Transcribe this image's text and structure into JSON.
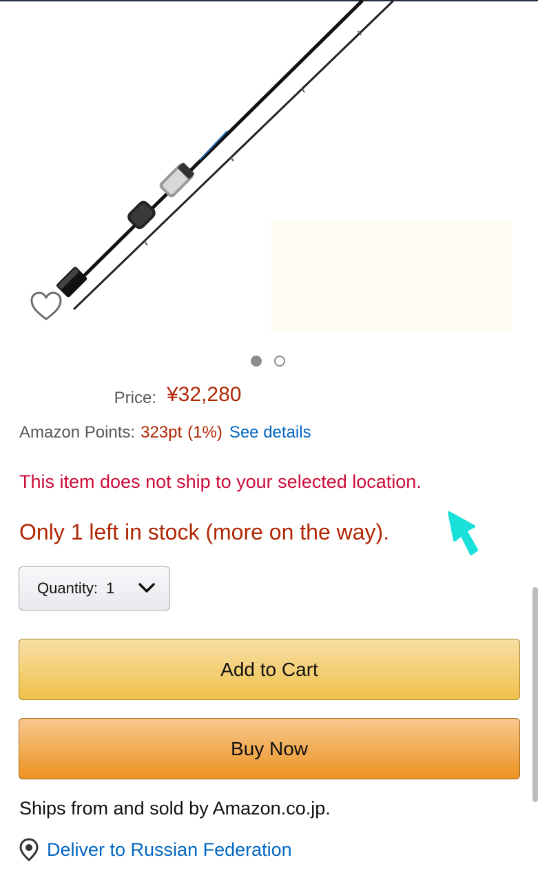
{
  "product": {
    "image_icon": "fishing-rod-product-image",
    "wishlist_icon": "heart-outline-icon",
    "carousel_pages": 2,
    "carousel_active": 1
  },
  "price": {
    "label": "Price:",
    "value": "¥32,280"
  },
  "points": {
    "label": "Amazon Points:",
    "value": "323pt",
    "percent": "(1%)",
    "link": "See details"
  },
  "alerts": {
    "no_ship": "This item does not ship to your selected location.",
    "stock": "Only 1 left in stock (more on the way)."
  },
  "quantity": {
    "label": "Quantity:",
    "value": "1",
    "icon": "chevron-down-icon"
  },
  "buttons": {
    "add_to_cart": "Add to Cart",
    "buy_now": "Buy Now"
  },
  "seller": {
    "text": "Ships from and sold by Amazon.co.jp."
  },
  "delivery": {
    "icon": "location-pin-icon",
    "text": "Deliver to Russian Federation"
  },
  "colors": {
    "price": "#b12704",
    "alert": "#cc0c39",
    "link": "#0066c0",
    "cart_button": "#f0c14b",
    "buy_button": "#ed9220"
  }
}
